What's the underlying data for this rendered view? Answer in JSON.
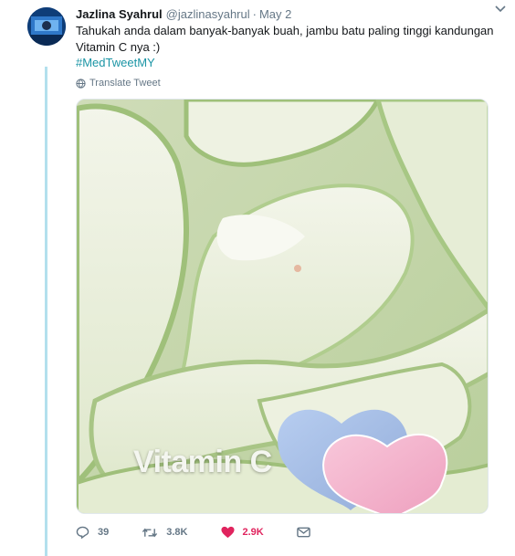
{
  "tweet": {
    "author_name": "Jazlina Syahrul",
    "author_handle": "@jazlinasyahrul",
    "separator": "·",
    "date": "May 2",
    "text": "Tahukah anda dalam banyak-banyak buah, jambu batu paling tinggi kandungan Vitamin C nya :)",
    "hashtag": "#MedTweetMY",
    "translate_label": "Translate Tweet",
    "image_overlay_text": "Vitamin C"
  },
  "actions": {
    "reply_count": "39",
    "retweet_count": "3.8K",
    "like_count": "2.9K",
    "like_active": true
  },
  "icons": [
    "caret-down-icon",
    "globe-icon",
    "reply-icon",
    "retweet-icon",
    "heart-icon",
    "message-icon"
  ],
  "colors": {
    "thread_line": "#b3e0ed",
    "hashtag": "#1b95a5",
    "like_active": "#e0245e",
    "muted": "#657786",
    "heart_blue": "#a8c1e6",
    "heart_pink": "#f4b6ce"
  }
}
